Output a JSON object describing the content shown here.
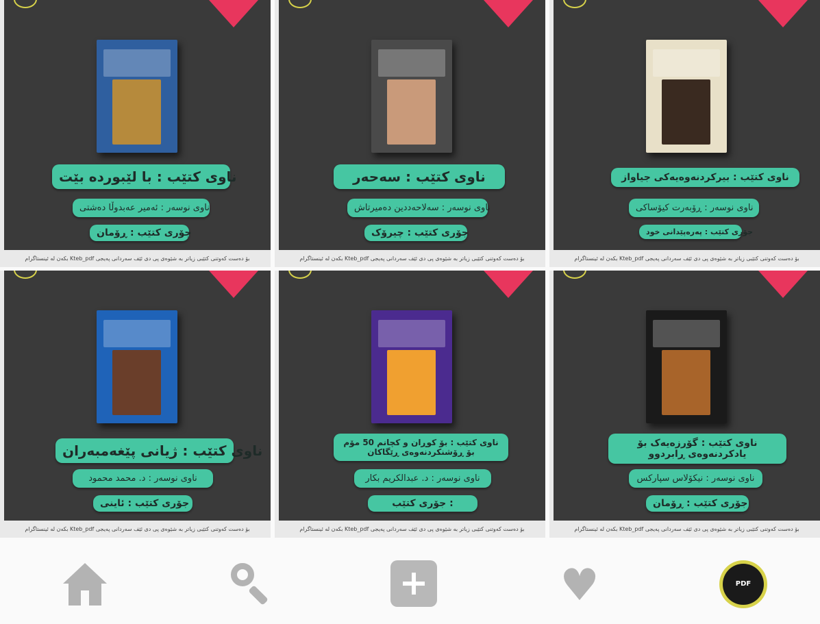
{
  "posts": [
    {
      "title_label": "ناوی کتێب :",
      "title": "با لێبوردە بێت",
      "author_label": "ناوی نوسەر :",
      "author": "ئەمیر عەبدوڵا دەشتی",
      "genre_label": "جۆری کتێب :",
      "genre": "ڕۆمان",
      "footer": "بۆ دەست کەوتنی کتێبی زیاتر بە شێوەی پی دی ئێف سەردانی پەیجی Kteb_pdf بکەن لە ئینستاگرام",
      "cover_color": "#2f5f9f",
      "pic_color": "#b68a3c"
    },
    {
      "title_label": "ناوی کتێب :",
      "title": "سەحەر",
      "author_label": "ناوی نوسەر :",
      "author": "سەلاحەددین دەمیرتاش",
      "genre_label": "جۆری کتێب :",
      "genre": "چیرۆک",
      "footer": "بۆ دەست کەوتنی کتێبی زیاتر بە شێوەی پی دی ئێف سەردانی پەیجی Kteb_pdf بکەن لە ئینستاگرام",
      "cover_color": "#4a4a4a",
      "pic_color": "#c99a7a"
    },
    {
      "title_label": "ناوی کتێب :",
      "title": "بیرکردنەوەیەکی جیاواز",
      "author_label": "ناوی نوسەر :",
      "author": "ڕۆبەرت کیۆساکی",
      "genre_label": "جۆری کتێب :",
      "genre": "پەرەپێدانی خود",
      "footer": "بۆ دەست کەوتنی کتێبی زیاتر بە شێوەی پی دی ئێف سەردانی پەیجی Kteb_pdf بکەن لە ئینستاگرام",
      "cover_color": "#e8e0c8",
      "pic_color": "#3a2a20"
    },
    {
      "title_label": "ناوی کتێب :",
      "title": "ژیانی پێغەمبەران",
      "author_label": "ناوی نوسەر :",
      "author": "د. محمد محمود",
      "genre_label": "جۆری کتێب :",
      "genre": "ئاینی",
      "footer": "بۆ دەست کەوتنی کتێبی زیاتر بە شێوەی پی دی ئێف سەردانی پەیجی Kteb_pdf بکەن لە ئینستاگرام",
      "cover_color": "#1f63b8",
      "pic_color": "#6a3e2a"
    },
    {
      "title_label": "ناوی کتێب :",
      "title": "بۆ کوڕان و کچانم 50 مۆم\nبۆ ڕۆشنکردنەوەی ڕێگاکان",
      "author_label": "ناوی نوسەر :",
      "author": "د. عبدالکریم بکار",
      "genre_label": "جۆری کتێب :",
      "genre": "",
      "footer": "بۆ دەست کەوتنی کتێبی زیاتر بە شێوەی پی دی ئێف سەردانی پەیجی Kteb_pdf بکەن لە ئینستاگرام",
      "cover_color": "#4b2b8f",
      "pic_color": "#f0a030"
    },
    {
      "title_label": "ناوی کتێب :",
      "title": "گۆرزەیەک بۆ\nیادکردنەوەی ڕابردوو",
      "author_label": "ناوی نوسەر :",
      "author": "نیکۆلاس سپارکس",
      "genre_label": "جۆری کتێب :",
      "genre": "ڕۆمان",
      "footer": "بۆ دەست کەوتنی کتێبی زیاتر بە شێوەی پی دی ئێف سەردانی پەیجی Kteb_pdf بکەن لە ئینستاگرام",
      "cover_color": "#1a1a1a",
      "pic_color": "#a8642a"
    }
  ],
  "nav": {
    "avatar_text": "PDF"
  },
  "colors": {
    "accent": "#46c6a2",
    "corner": "#e8365d",
    "panel": "#3a3a3a"
  }
}
